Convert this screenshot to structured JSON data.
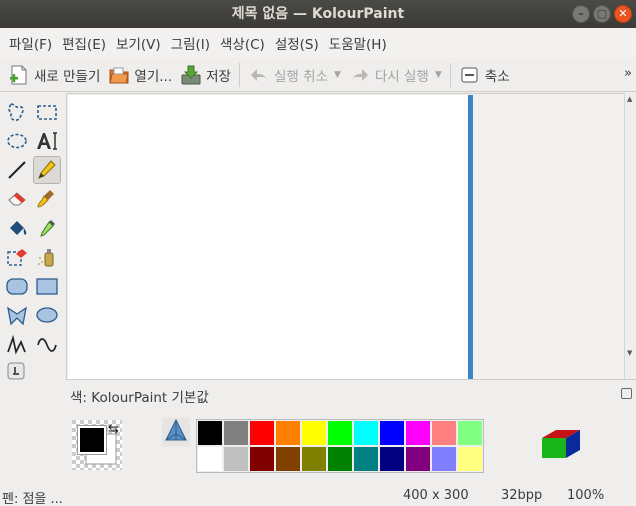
{
  "window": {
    "title": "제목 없음 — KolourPaint",
    "buttons": {
      "minimize": "–",
      "maximize": "▢",
      "close": "✕"
    }
  },
  "menu": [
    "파일(F)",
    "편집(E)",
    "보기(V)",
    "그림(I)",
    "색상(C)",
    "설정(S)",
    "도움말(H)"
  ],
  "toolbar": {
    "new_label": "새로 만들기",
    "open_label": "열기...",
    "save_label": "저장",
    "undo_label": "실행 취소",
    "redo_label": "다시 실행",
    "zoom_out_label": "축소",
    "more": "»"
  },
  "tools": [
    {
      "name": "free-form-selection-icon",
      "glyph": "✂"
    },
    {
      "name": "rectangular-selection-icon",
      "glyph": ""
    },
    {
      "name": "elliptical-selection-icon",
      "glyph": ""
    },
    {
      "name": "text-tool-icon",
      "glyph": "AI"
    },
    {
      "name": "line-tool-icon",
      "glyph": ""
    },
    {
      "name": "pen-tool-icon",
      "glyph": "✏"
    },
    {
      "name": "eraser-tool-icon",
      "glyph": ""
    },
    {
      "name": "brush-tool-icon",
      "glyph": ""
    },
    {
      "name": "flood-fill-tool-icon",
      "glyph": ""
    },
    {
      "name": "color-picker-tool-icon",
      "glyph": ""
    },
    {
      "name": "color-eraser-tool-icon",
      "glyph": ""
    },
    {
      "name": "spraycan-tool-icon",
      "glyph": ""
    },
    {
      "name": "rounded-rectangle-tool-icon",
      "glyph": ""
    },
    {
      "name": "rectangle-tool-icon",
      "glyph": ""
    },
    {
      "name": "polygon-tool-icon",
      "glyph": ""
    },
    {
      "name": "ellipse-tool-icon",
      "glyph": ""
    },
    {
      "name": "polyline-tool-icon",
      "glyph": ""
    },
    {
      "name": "curve-tool-icon",
      "glyph": ""
    },
    {
      "name": "tool-options-icon",
      "glyph": ""
    }
  ],
  "colour_panel": {
    "label": "색: KolourPaint 기본값",
    "foreground": "#000000",
    "background": "#ffffff",
    "palette_row1": [
      "#000000",
      "#808080",
      "#ff0000",
      "#ff8000",
      "#ffff00",
      "#00ff00",
      "#00ffff",
      "#0000ff",
      "#ff00ff",
      "#ff8080",
      "#80ff80"
    ],
    "palette_row2": [
      "#ffffff",
      "#c0c0c0",
      "#800000",
      "#804000",
      "#808000",
      "#008000",
      "#008080",
      "#000080",
      "#800080",
      "#8080ff",
      "#ffff80"
    ]
  },
  "status": {
    "message": "펜: 점을 ...",
    "size": "400 x 300",
    "depth": "32bpp",
    "zoom": "100%"
  },
  "colors": {
    "accent": "#3d86c6",
    "titlebar": "#3b3a37",
    "close_button": "#e9541f"
  }
}
